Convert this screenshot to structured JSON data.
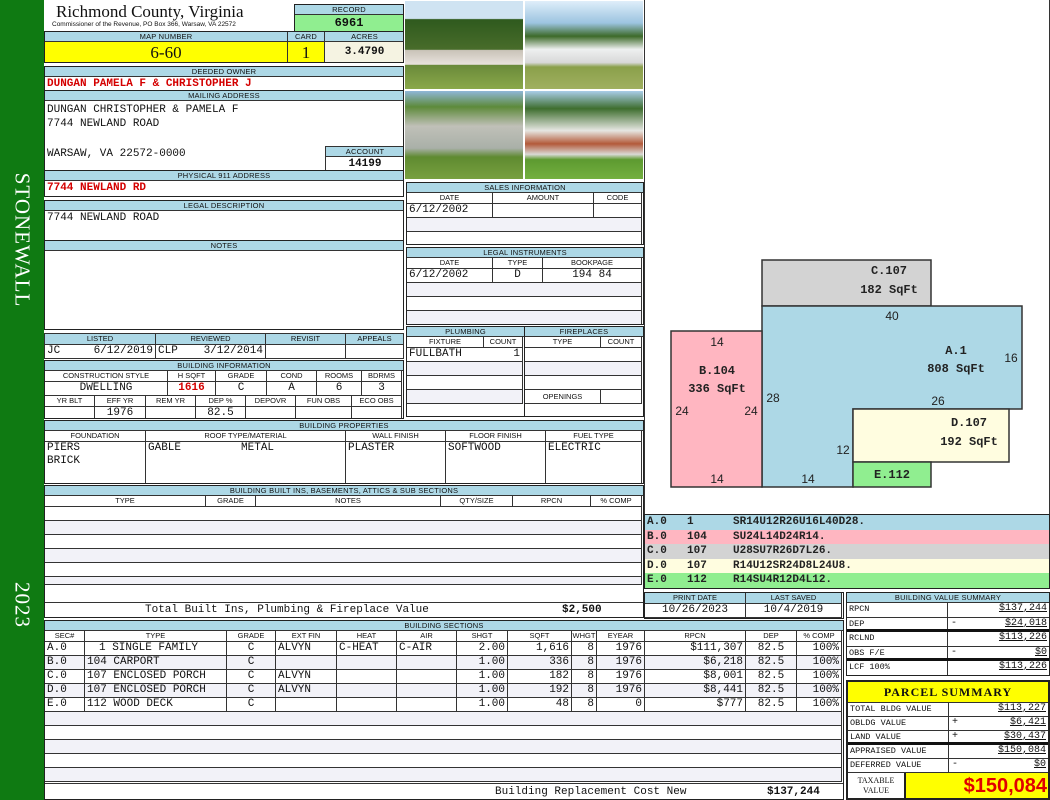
{
  "side": {
    "district": "STONEWALL",
    "year": "2023"
  },
  "header": {
    "county": "Richmond County, Virginia",
    "address": "Commissioner of the Revenue, PO Box 366, Warsaw, VA 22572",
    "record_label": "RECORD",
    "record": "6961"
  },
  "parcel": {
    "map_label": "MAP NUMBER",
    "map": "6-60",
    "card_label": "CARD",
    "card": "1",
    "acres_label": "ACRES",
    "acres": "3.4790"
  },
  "owner": {
    "label": "DEEDED OWNER",
    "name": "DUNGAN PAMELA F & CHRISTOPHER J"
  },
  "mailing": {
    "label": "MAILING ADDRESS",
    "lines": [
      "DUNGAN CHRISTOPHER & PAMELA F",
      "7744 NEWLAND ROAD",
      "WARSAW, VA 22572-0000"
    ]
  },
  "account": {
    "label": "ACCOUNT",
    "value": "14199"
  },
  "physical": {
    "label": "PHYSICAL 911 ADDRESS",
    "value": "7744 NEWLAND RD"
  },
  "legal": {
    "label": "LEGAL DESCRIPTION",
    "value": "7744 NEWLAND ROAD"
  },
  "notes": {
    "label": "NOTES"
  },
  "review": {
    "headers": [
      "LISTED",
      "REVIEWED",
      "REVISIT",
      "APPEALS"
    ],
    "listed_by": "JC",
    "listed_date": "6/12/2019",
    "reviewed_by": "CLP",
    "reviewed_date": "3/12/2014"
  },
  "bldg_info": {
    "label": "BUILDING INFORMATION",
    "headers1": [
      "CONSTRUCTION STYLE",
      "H SQFT",
      "GRADE",
      "COND",
      "ROOMS",
      "BDRMS"
    ],
    "values1": [
      "DWELLING",
      "1616",
      "C",
      "A",
      "6",
      "3"
    ],
    "headers2": [
      "YR BLT",
      "EFF YR",
      "REM YR",
      "DEP %",
      "DEPOVR",
      "FUN OBS",
      "ECO OBS"
    ],
    "values2": [
      "",
      "1976",
      "",
      "82.5",
      "",
      "",
      ""
    ]
  },
  "sales": {
    "label": "SALES INFORMATION",
    "headers": [
      "DATE",
      "AMOUNT",
      "CODE"
    ],
    "rows": [
      [
        "6/12/2002",
        "",
        ""
      ]
    ]
  },
  "instruments": {
    "label": "LEGAL INSTRUMENTS",
    "headers": [
      "DATE",
      "TYPE",
      "BOOKPAGE"
    ],
    "rows": [
      [
        "6/12/2002",
        "D",
        "194 84"
      ]
    ]
  },
  "plumbing": {
    "label": "PLUMBING",
    "headers": [
      "FIXTURE",
      "COUNT"
    ],
    "rows": [
      [
        "FULLBATH",
        "1"
      ]
    ]
  },
  "fireplaces": {
    "label": "FIREPLACES",
    "headers": [
      "TYPE",
      "COUNT"
    ],
    "openings_label": "OPENINGS"
  },
  "properties": {
    "label": "BUILDING PROPERTIES",
    "headers": [
      "FOUNDATION",
      "ROOF TYPE/MATERIAL",
      "WALL FINISH",
      "FLOOR FINISH",
      "FUEL TYPE"
    ],
    "foundation": [
      "PIERS",
      "BRICK"
    ],
    "roof_type": "GABLE",
    "roof_material": "METAL",
    "wall": "PLASTER",
    "floor": "SOFTWOOD",
    "fuel": "ELECTRIC"
  },
  "builtins": {
    "label": "BUILDING BUILT INS, BASEMENTS, ATTICS & SUB SECTIONS",
    "headers": [
      "TYPE",
      "GRADE",
      "NOTES",
      "QTY/SIZE",
      "RPCN",
      "% COMP"
    ],
    "total_label": "Total Built Ins, Plumbing & Fireplace Value",
    "total": "$2,500"
  },
  "dates": {
    "print_label": "PRINT DATE",
    "print": "10/26/2023",
    "saved_label": "LAST SAVED",
    "saved": "10/4/2019"
  },
  "sections": {
    "label": "BUILDING SECTIONS",
    "headers": [
      "SEC#",
      "TYPE",
      "GRADE",
      "EXT FIN",
      "HEAT",
      "AIR",
      "SHGT",
      "SQFT",
      "WHGT",
      "EYEAR",
      "RPCN",
      "DEP",
      "% COMP"
    ],
    "rows": [
      [
        "A.0",
        "1 SINGLE FAMILY",
        "C",
        "ALVYN",
        "C-HEAT",
        "C-AIR",
        "2.00",
        "1,616",
        "8",
        "1976",
        "$111,307",
        "82.5",
        "100%"
      ],
      [
        "B.0",
        "104 CARPORT",
        "C",
        "",
        "",
        "",
        "1.00",
        "336",
        "8",
        "1976",
        "$6,218",
        "82.5",
        "100%"
      ],
      [
        "C.0",
        "107 ENCLOSED PORCH",
        "C",
        "ALVYN",
        "",
        "",
        "1.00",
        "182",
        "8",
        "1976",
        "$8,001",
        "82.5",
        "100%"
      ],
      [
        "D.0",
        "107 ENCLOSED PORCH",
        "C",
        "ALVYN",
        "",
        "",
        "1.00",
        "192",
        "8",
        "1976",
        "$8,441",
        "82.5",
        "100%"
      ],
      [
        "E.0",
        "112 WOOD DECK",
        "C",
        "",
        "",
        "",
        "1.00",
        "48",
        "8",
        "0",
        "$777",
        "82.5",
        "100%"
      ]
    ],
    "total_label": "Building Replacement Cost New",
    "total": "$137,244"
  },
  "sketch": {
    "labels": {
      "A": [
        "A.1",
        "808 SqFt"
      ],
      "B": [
        "B.104",
        "336 SqFt"
      ],
      "C": [
        "C.107",
        "182 SqFt"
      ],
      "D": [
        "D.107",
        "192 SqFt"
      ],
      "E": [
        "E.112"
      ]
    },
    "dims": [
      "14",
      "24",
      "24",
      "14",
      "28",
      "40",
      "16",
      "26",
      "12",
      "14"
    ],
    "codes": [
      [
        "A.0",
        "1",
        "SR14U12R26U16L40D28."
      ],
      [
        "B.0",
        "104",
        "SU24L14D24R14."
      ],
      [
        "C.0",
        "107",
        "U28SU7R26D7L26."
      ],
      [
        "D.0",
        "107",
        "R14U12SR24D8L24U8."
      ],
      [
        "E.0",
        "112",
        "R14SU4R12D4L12."
      ]
    ],
    "colors": {
      "A": "#add8e6",
      "B": "#ffb6c1",
      "C": "#d3d3d3",
      "D": "#fffde0",
      "E": "#90ee90"
    }
  },
  "value_summary": {
    "label": "BUILDING VALUE SUMMARY",
    "rows": [
      [
        "RPCN",
        "",
        "$137,244"
      ],
      [
        "DEP",
        "-",
        "$24,018"
      ],
      [
        "RCLND",
        "",
        "$113,226"
      ],
      [
        "OBS F/E",
        "-",
        "$0"
      ],
      [
        "LCF 100%",
        "",
        "$113,226"
      ]
    ]
  },
  "parcel_summary": {
    "title": "PARCEL SUMMARY",
    "rows": [
      [
        "TOTAL BLDG VALUE",
        "",
        "$113,227"
      ],
      [
        "OBLDG VALUE",
        "+",
        "$6,421"
      ],
      [
        "LAND VALUE",
        "+",
        "$30,437"
      ],
      [
        "APPRAISED VALUE",
        "",
        "$150,084"
      ],
      [
        "DEFERRED VALUE",
        "-",
        "$0"
      ]
    ],
    "taxable_label": "TAXABLE VALUE",
    "taxable": "$150,084"
  }
}
